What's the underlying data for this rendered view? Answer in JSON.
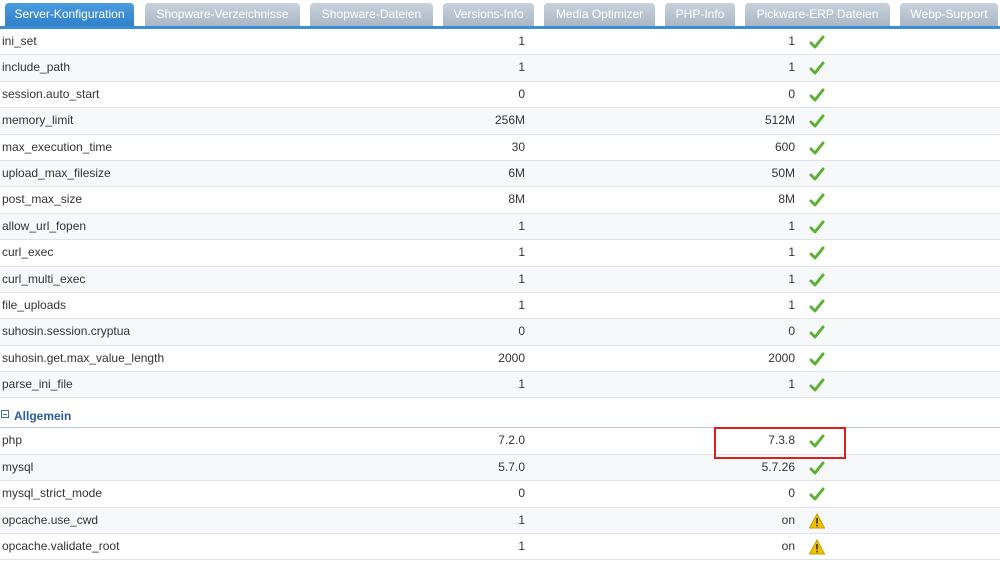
{
  "tabs": [
    {
      "label": "Server-Konfiguration",
      "active": true
    },
    {
      "label": "Shopware-Verzeichnisse",
      "active": false
    },
    {
      "label": "Shopware-Dateien",
      "active": false
    },
    {
      "label": "Versions-Info",
      "active": false
    },
    {
      "label": "Media Optimizer",
      "active": false
    },
    {
      "label": "PHP-Info",
      "active": false
    },
    {
      "label": "Pickware-ERP Dateien",
      "active": false
    },
    {
      "label": "Webp-Support",
      "active": false
    }
  ],
  "php_rows": [
    {
      "name": "ini_set",
      "required": "1",
      "current": "1",
      "status": "ok"
    },
    {
      "name": "include_path",
      "required": "1",
      "current": "1",
      "status": "ok"
    },
    {
      "name": "session.auto_start",
      "required": "0",
      "current": "0",
      "status": "ok"
    },
    {
      "name": "memory_limit",
      "required": "256M",
      "current": "512M",
      "status": "ok"
    },
    {
      "name": "max_execution_time",
      "required": "30",
      "current": "600",
      "status": "ok"
    },
    {
      "name": "upload_max_filesize",
      "required": "6M",
      "current": "50M",
      "status": "ok"
    },
    {
      "name": "post_max_size",
      "required": "8M",
      "current": "8M",
      "status": "ok"
    },
    {
      "name": "allow_url_fopen",
      "required": "1",
      "current": "1",
      "status": "ok"
    },
    {
      "name": "curl_exec",
      "required": "1",
      "current": "1",
      "status": "ok"
    },
    {
      "name": "curl_multi_exec",
      "required": "1",
      "current": "1",
      "status": "ok"
    },
    {
      "name": "file_uploads",
      "required": "1",
      "current": "1",
      "status": "ok"
    },
    {
      "name": "suhosin.session.cryptua",
      "required": "0",
      "current": "0",
      "status": "ok"
    },
    {
      "name": "suhosin.get.max_value_length",
      "required": "2000",
      "current": "2000",
      "status": "ok"
    },
    {
      "name": "parse_ini_file",
      "required": "1",
      "current": "1",
      "status": "ok"
    }
  ],
  "section_allgemein": {
    "title": "Allgemein"
  },
  "allgemein_rows": [
    {
      "name": "php",
      "required": "7.2.0",
      "current": "7.3.8",
      "status": "ok"
    },
    {
      "name": "mysql",
      "required": "5.7.0",
      "current": "5.7.26",
      "status": "ok"
    },
    {
      "name": "mysql_strict_mode",
      "required": "0",
      "current": "0",
      "status": "ok"
    },
    {
      "name": "opcache.use_cwd",
      "required": "1",
      "current": "on",
      "status": "warning"
    },
    {
      "name": "opcache.validate_root",
      "required": "1",
      "current": "on",
      "status": "warning"
    }
  ],
  "colors": {
    "accent": "#3a8ed6",
    "ok": "#5cb135",
    "warning": "#f2c200",
    "highlight": "#e01e1e"
  }
}
